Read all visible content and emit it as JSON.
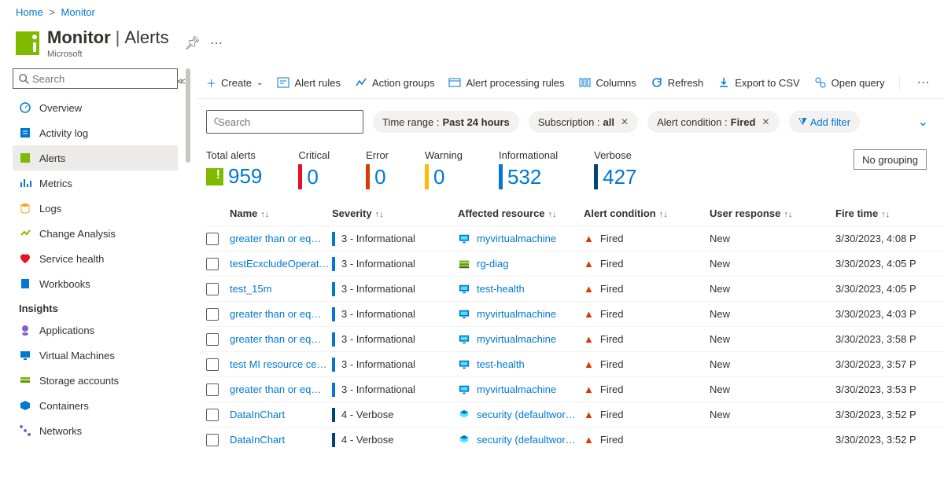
{
  "breadcrumb": {
    "home": "Home",
    "monitor": "Monitor"
  },
  "header": {
    "service": "Monitor",
    "page": "Alerts",
    "owner": "Microsoft"
  },
  "sidebar": {
    "search_ph": "Search",
    "items": [
      {
        "label": "Overview"
      },
      {
        "label": "Activity log"
      },
      {
        "label": "Alerts"
      },
      {
        "label": "Metrics"
      },
      {
        "label": "Logs"
      },
      {
        "label": "Change Analysis"
      },
      {
        "label": "Service health"
      },
      {
        "label": "Workbooks"
      }
    ],
    "section": "Insights",
    "insights": [
      {
        "label": "Applications"
      },
      {
        "label": "Virtual Machines"
      },
      {
        "label": "Storage accounts"
      },
      {
        "label": "Containers"
      },
      {
        "label": "Networks"
      }
    ]
  },
  "toolbar": {
    "create": "Create",
    "rules": "Alert rules",
    "groups": "Action groups",
    "processing": "Alert processing rules",
    "columns": "Columns",
    "refresh": "Refresh",
    "export": "Export to CSV",
    "open": "Open query"
  },
  "filters": {
    "search_ph": "Search",
    "time": {
      "label": "Time range :",
      "value": "Past 24 hours"
    },
    "sub": {
      "label": "Subscription :",
      "value": "all"
    },
    "cond": {
      "label": "Alert condition :",
      "value": "Fired"
    },
    "add": "Add filter"
  },
  "counts": {
    "total": {
      "label": "Total alerts",
      "value": "959"
    },
    "critical": {
      "label": "Critical",
      "value": "0",
      "color": "#e81123"
    },
    "error": {
      "label": "Error",
      "value": "0",
      "color": "#da3b01"
    },
    "warning": {
      "label": "Warning",
      "value": "0",
      "color": "#ffb900"
    },
    "info": {
      "label": "Informational",
      "value": "532",
      "color": "#0078d4"
    },
    "verbose": {
      "label": "Verbose",
      "value": "427",
      "color": "#004578"
    }
  },
  "grouping": "No grouping",
  "columns": [
    "Name",
    "Severity",
    "Affected resource",
    "Alert condition",
    "User response",
    "Fire time"
  ],
  "rows": [
    {
      "name": "greater than or eq…",
      "sev": "3 - Informational",
      "sv": "i",
      "res": "myvirtualmachine",
      "rt": "vm",
      "cond": "Fired",
      "resp": "New",
      "time": "3/30/2023, 4:08 P"
    },
    {
      "name": "testEcxcludeOperat…",
      "sev": "3 - Informational",
      "sv": "i",
      "res": "rg-diag",
      "rt": "rg",
      "cond": "Fired",
      "resp": "New",
      "time": "3/30/2023, 4:05 P"
    },
    {
      "name": "test_15m",
      "sev": "3 - Informational",
      "sv": "i",
      "res": "test-health",
      "rt": "vm",
      "cond": "Fired",
      "resp": "New",
      "time": "3/30/2023, 4:05 P"
    },
    {
      "name": "greater than or eq…",
      "sev": "3 - Informational",
      "sv": "i",
      "res": "myvirtualmachine",
      "rt": "vm",
      "cond": "Fired",
      "resp": "New",
      "time": "3/30/2023, 4:03 P"
    },
    {
      "name": "greater than or eq…",
      "sev": "3 - Informational",
      "sv": "i",
      "res": "myvirtualmachine",
      "rt": "vm",
      "cond": "Fired",
      "resp": "New",
      "time": "3/30/2023, 3:58 P"
    },
    {
      "name": "test MI resource ce…",
      "sev": "3 - Informational",
      "sv": "i",
      "res": "test-health",
      "rt": "vm",
      "cond": "Fired",
      "resp": "New",
      "time": "3/30/2023, 3:57 P"
    },
    {
      "name": "greater than or eq…",
      "sev": "3 - Informational",
      "sv": "i",
      "res": "myvirtualmachine",
      "rt": "vm",
      "cond": "Fired",
      "resp": "New",
      "time": "3/30/2023, 3:53 P"
    },
    {
      "name": "DataInChart",
      "sev": "4 - Verbose",
      "sv": "v",
      "res": "security (defaultwor…",
      "rt": "sec",
      "cond": "Fired",
      "resp": "New",
      "time": "3/30/2023, 3:52 P"
    },
    {
      "name": "DataInChart",
      "sev": "4 - Verbose",
      "sv": "v",
      "res": "security (defaultwor…",
      "rt": "sec",
      "cond": "Fired",
      "resp": "",
      "time": "3/30/2023, 3:52 P"
    }
  ]
}
